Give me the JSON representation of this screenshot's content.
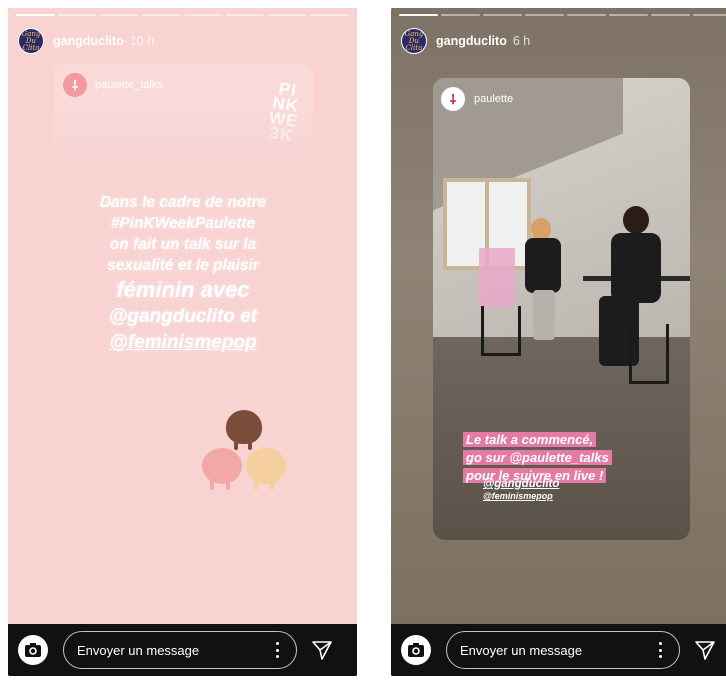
{
  "stories": [
    {
      "username": "gangduclito",
      "time": "10 h",
      "avatar_text": "Gang Du Clito",
      "progress_segments": 8,
      "progress_done": 1,
      "repost": {
        "username": "paulette_talks",
        "avatar_glyph": "⸸",
        "sticker_text": [
          "PI",
          "NK",
          "WE",
          "3K"
        ]
      },
      "overlay_lines": [
        "Dans le cadre de notre",
        "#PinKWeekPaulette",
        "on fait un talk sur la",
        "sexualité et le plaisir",
        "féminin avec",
        "@gangduclito et",
        "@feminismepop"
      ]
    },
    {
      "username": "gangduclito",
      "time": "6 h",
      "avatar_text": "Gang Du Clito",
      "progress_segments": 8,
      "progress_done": 1,
      "post": {
        "username": "paulette",
        "avatar_glyph": "⸸"
      },
      "caption_lines": [
        "Le talk a commencé,",
        "go sur @paulette_talks",
        "pour le suivre en live !"
      ],
      "tags": [
        "@gangduclito",
        "@feminismepop"
      ]
    }
  ],
  "message_bar": {
    "placeholder": "Envoyer un message",
    "camera_icon": "camera-icon",
    "more_icon": "more-vertical-icon",
    "send_icon": "send-icon"
  },
  "colors": {
    "story1_bg": "#f8d3d2",
    "caption_pill": "#e57aa5",
    "bar_bg": "#111111"
  }
}
